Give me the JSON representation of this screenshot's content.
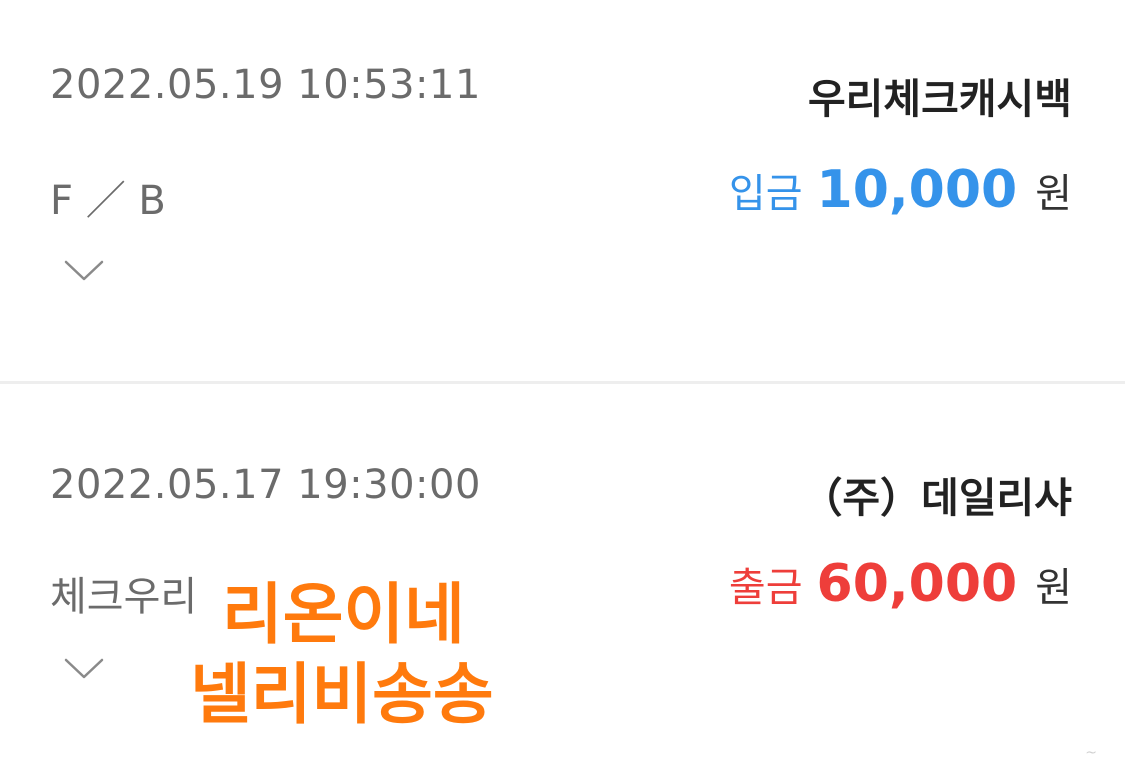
{
  "transactions": [
    {
      "datetime": "2022.05.19  10:53:11",
      "merchant": "우리체크캐시백",
      "memo": "F ／ B",
      "type_label": "입금",
      "amount": "10,000",
      "currency": "원",
      "color": "#3593ea"
    },
    {
      "datetime": "2022.05.17  19:30:00",
      "merchant": "（주）데일리샤",
      "memo": "체크우리",
      "type_label": "출금",
      "amount": "60,000",
      "currency": "원",
      "color": "#ee3e3a"
    }
  ],
  "overlay": {
    "line1": "리온이네",
    "line2": "넬리비송송",
    "color": "#ff7a0d"
  },
  "icons": {
    "expand": "chevron-down-icon"
  }
}
